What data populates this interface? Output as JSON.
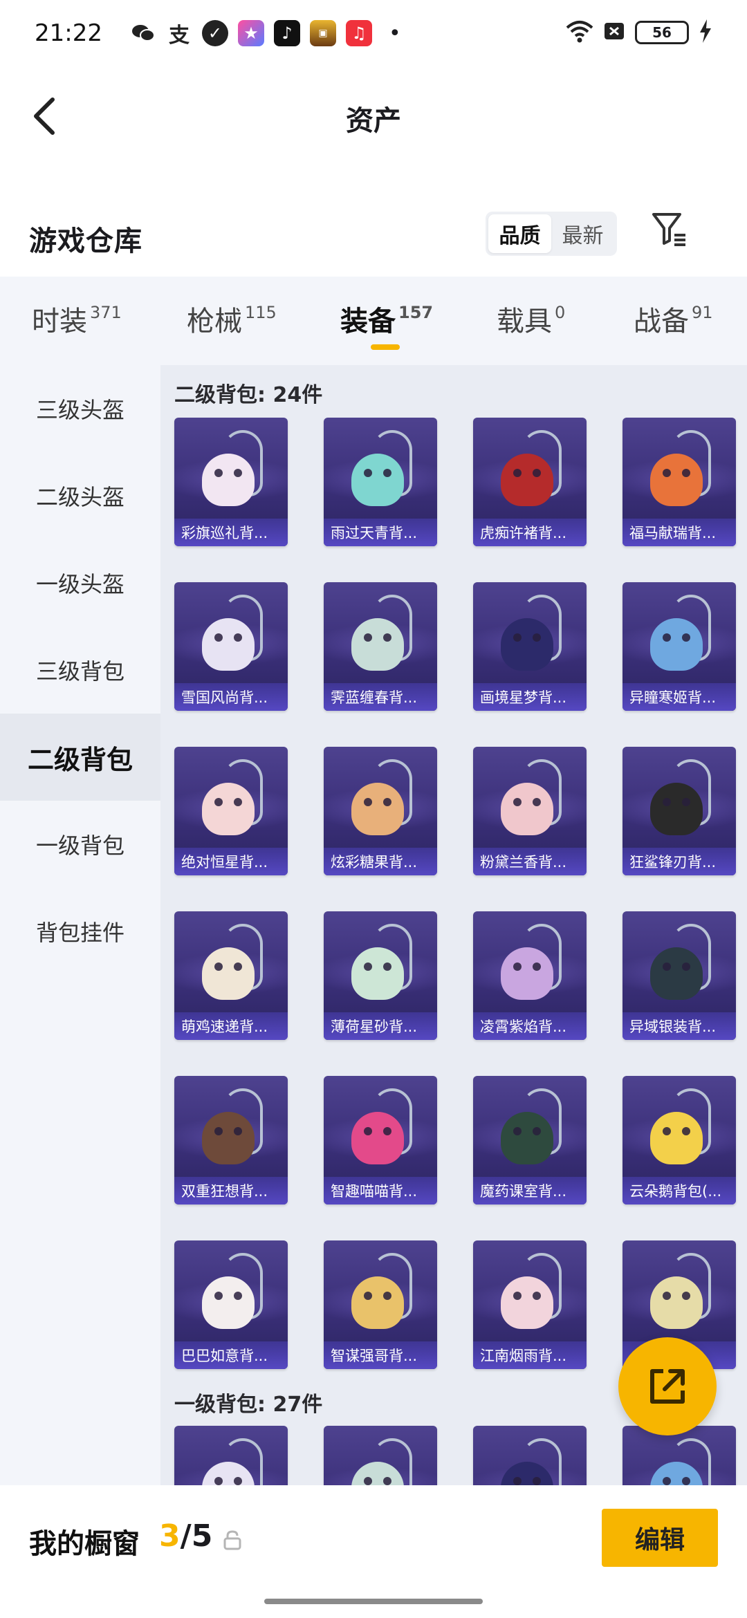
{
  "status_bar": {
    "time": "21:22",
    "battery": "56",
    "notification_icons": [
      "wechat-icon",
      "alipay-icon",
      "shield-app-icon",
      "star-app-icon",
      "tiktok-icon",
      "game-app-icon",
      "music-app-icon"
    ],
    "more_dot": "•"
  },
  "header": {
    "title": "资产",
    "back_icon": "chevron-left-icon"
  },
  "warehouse": {
    "title": "游戏仓库",
    "sort_options": [
      "品质",
      "最新"
    ],
    "active_sort": "品质",
    "filter_icon": "filter-icon"
  },
  "category_tabs": [
    {
      "label": "时装",
      "count": "371"
    },
    {
      "label": "枪械",
      "count": "115"
    },
    {
      "label": "装备",
      "count": "157"
    },
    {
      "label": "载具",
      "count": "0"
    },
    {
      "label": "战备",
      "count": "91"
    }
  ],
  "active_category": "装备",
  "sidebar": {
    "items": [
      "三级头盔",
      "二级头盔",
      "一级头盔",
      "三级背包",
      "二级背包",
      "一级背包",
      "背包挂件"
    ],
    "active": "二级背包"
  },
  "sections": [
    {
      "title": "二级背包: 24件",
      "items": [
        "彩旗巡礼背...",
        "雨过天青背...",
        "虎痴许褚背...",
        "福马献瑞背...",
        "雪国风尚背...",
        "霁蓝缠春背...",
        "画境星梦背...",
        "异瞳寒姬背...",
        "绝对恒星背...",
        "炫彩糖果背...",
        "粉黛兰香背...",
        "狂鲨锋刃背...",
        "萌鸡速递背...",
        "薄荷星砂背...",
        "凌霄紫焰背...",
        "异域银装背...",
        "双重狂想背...",
        "智趣喵喵背...",
        "魔药课室背...",
        "云朵鹅背包(...",
        "巴巴如意背...",
        "智谋强哥背...",
        "江南烟雨背...",
        "..."
      ]
    },
    {
      "title": "一级背包: 27件",
      "items": [
        "",
        "",
        "",
        ""
      ]
    }
  ],
  "colors": {
    "accent": "#f7b500",
    "card_top": "#4e428f",
    "card_bottom": "#2b2460",
    "label_bg": "#584ac8"
  },
  "bottom_bar": {
    "label": "我的橱窗",
    "current": "3",
    "total": "/5",
    "lock_icon": "lock-icon",
    "edit_label": "编辑"
  },
  "fab": {
    "icon": "external-link-icon"
  }
}
